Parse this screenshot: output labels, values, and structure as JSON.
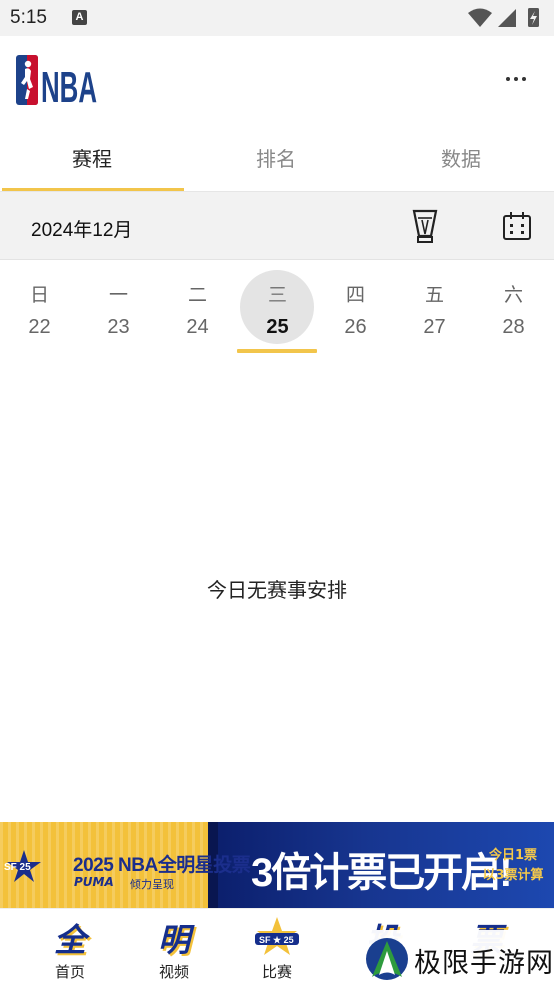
{
  "status_bar": {
    "time": "5:15",
    "notification_icon": "A",
    "icons": [
      "wifi-icon",
      "signal-icon",
      "battery-charging-icon"
    ]
  },
  "header": {
    "logo_text": "NBA",
    "more_icon": "more-dots-icon"
  },
  "tabs": [
    {
      "label": "赛程",
      "active": true
    },
    {
      "label": "排名",
      "active": false
    },
    {
      "label": "数据",
      "active": false
    }
  ],
  "date_bar": {
    "month": "2024年12月",
    "trophy_icon": "trophy-icon",
    "calendar_icon": "calendar-icon"
  },
  "week": [
    {
      "weekday": "日",
      "date": "22",
      "selected": false
    },
    {
      "weekday": "一",
      "date": "23",
      "selected": false
    },
    {
      "weekday": "二",
      "date": "24",
      "selected": false
    },
    {
      "weekday": "三",
      "date": "25",
      "selected": true
    },
    {
      "weekday": "四",
      "date": "26",
      "selected": false
    },
    {
      "weekday": "五",
      "date": "27",
      "selected": false
    },
    {
      "weekday": "六",
      "date": "28",
      "selected": false
    }
  ],
  "empty_message": "今日无赛事安排",
  "banner": {
    "title": "2025 NBA全明星投票",
    "sponsor": "PUMA",
    "sponsor_sub": "倾力呈现",
    "headline": "3倍计票已开启!",
    "note_line1": "今日1票",
    "note_line2": "以3票计算",
    "badge_text": "SF 25"
  },
  "bottom_nav": [
    {
      "glyph": "全",
      "label": "首页"
    },
    {
      "glyph": "明",
      "label": "视频"
    },
    {
      "glyph": "",
      "label": "比赛"
    },
    {
      "glyph": "投",
      "label": ""
    },
    {
      "glyph": "票",
      "label": ""
    }
  ],
  "watermark": {
    "text": "极限手游网"
  },
  "colors": {
    "accent_yellow": "#f2c54b",
    "nba_blue": "#1d428a",
    "nba_red": "#c8102e",
    "selected_circle": "#e4e4e4"
  }
}
